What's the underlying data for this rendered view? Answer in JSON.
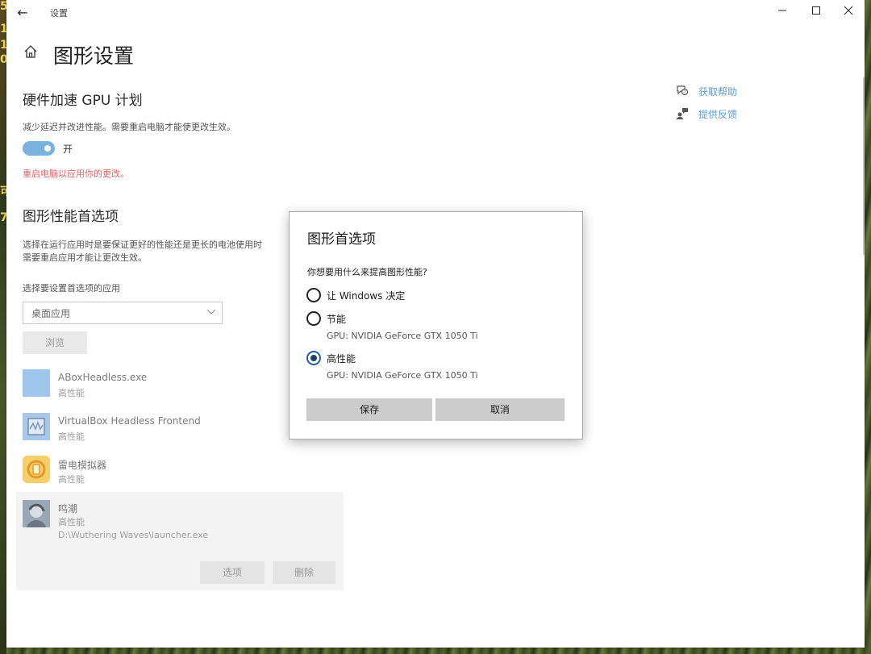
{
  "window": {
    "title": "设置",
    "back_glyph": "←",
    "minimize_glyph": "—",
    "maximize_glyph": "☐",
    "close_glyph": "✕"
  },
  "desktop": {
    "left_strip_chars": [
      "5",
      "1",
      "1",
      "0",
      "可",
      "7"
    ]
  },
  "page": {
    "title": "图形设置",
    "home_icon": "home-icon"
  },
  "gpu_scheduling": {
    "heading": "硬件加速 GPU 计划",
    "description": "减少延迟并改进性能。需要重启电脑才能使更改生效。",
    "toggle_on": true,
    "toggle_label": "开",
    "restart_notice": "重启电脑以应用你的更改。"
  },
  "graphics_prefs": {
    "heading": "图形性能首选项",
    "description_line1": "选择在运行应用时是要保证更好的性能还是更长的电池使用时",
    "description_line2": "需要重启应用才能让更改生效。",
    "select_label": "选择要设置首选项的应用",
    "select_value": "桌面应用",
    "browse_label": "浏览",
    "apps": [
      {
        "name": "ABoxHeadless.exe",
        "pref": "高性能",
        "path": ""
      },
      {
        "name": "VirtualBox Headless Frontend",
        "pref": "高性能",
        "path": ""
      },
      {
        "name": "雷电模拟器",
        "pref": "高性能",
        "path": ""
      },
      {
        "name": "鸣潮",
        "pref": "高性能",
        "path": "D:\\Wuthering Waves\\launcher.exe"
      }
    ],
    "options_button": "选项",
    "delete_button": "删除"
  },
  "side_links": {
    "help": "获取帮助",
    "feedback": "提供反馈"
  },
  "dialog": {
    "title": "图形首选项",
    "question": "你想要用什么来提高图形性能?",
    "options": [
      {
        "label": "让 Windows 决定",
        "gpu": "",
        "checked": false
      },
      {
        "label": "节能",
        "gpu": "GPU: NVIDIA GeForce GTX 1050 Ti",
        "checked": false
      },
      {
        "label": "高性能",
        "gpu": "GPU: NVIDIA GeForce GTX 1050 Ti",
        "checked": true
      }
    ],
    "save_button": "保存",
    "cancel_button": "取消"
  },
  "colors": {
    "accent": "#7ab3e0",
    "link": "#5c9ed6",
    "warning": "#e06464",
    "radio_selected": "#1f5fa8"
  }
}
